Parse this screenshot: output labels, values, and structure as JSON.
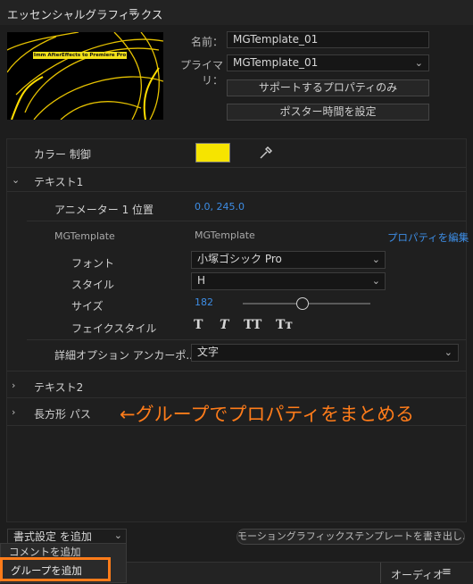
{
  "panel": {
    "title": "エッセンシャルグラフィックス",
    "menu_icon": "hamburger-menu-icon"
  },
  "preview": {
    "caption": "Imm AfterEffects to Premiere Pro"
  },
  "info": {
    "name_label": "名前：",
    "name_value": "MGTemplate_01",
    "primary_label": "プライマリ：",
    "primary_value": "MGTemplate_01",
    "solo_supported_label": "サポートするプロパティのみ",
    "poster_frame_label": "ポスター時間を設定"
  },
  "controls": {
    "color_control_label": "カラー 制御",
    "color_value": "#f6e400",
    "eyedropper_icon": "eyedropper-icon",
    "text1_label": "テキスト1",
    "animator_label": "アニメーター 1 位置",
    "animator_value": "0.0, 245.0",
    "mgt_left": "MGTemplate",
    "mgt_right": "MGTemplate",
    "edit_properties_link": "プロパティを編集",
    "font_label": "フォント",
    "font_value": "小塚ゴシック Pro",
    "style_label": "スタイル",
    "style_value": "H",
    "size_label": "サイズ",
    "size_value": "182",
    "size_slider_fraction": 0.47,
    "faux_style_label": "フェイクスタイル",
    "faux_buttons": [
      "T",
      "T",
      "TT",
      "Tт"
    ],
    "advanced_label": "詳細オプション アンカーポ...",
    "advanced_value": "文字",
    "text2_label": "テキスト2",
    "rect_path_label": "長方形 パス",
    "annotation": "←グループでプロパティをまとめる"
  },
  "footer": {
    "add_format_label": "書式設定 を追加",
    "export_button_label": "モーショングラフィックステンプレートを書き出し...",
    "menu_items": [
      "コメントを追加",
      "グループを追加"
    ],
    "audio_tab_label": "オーディオ"
  },
  "colors": {
    "accent_blue": "#3d8de5",
    "annotation_orange": "#ff7c1a"
  }
}
